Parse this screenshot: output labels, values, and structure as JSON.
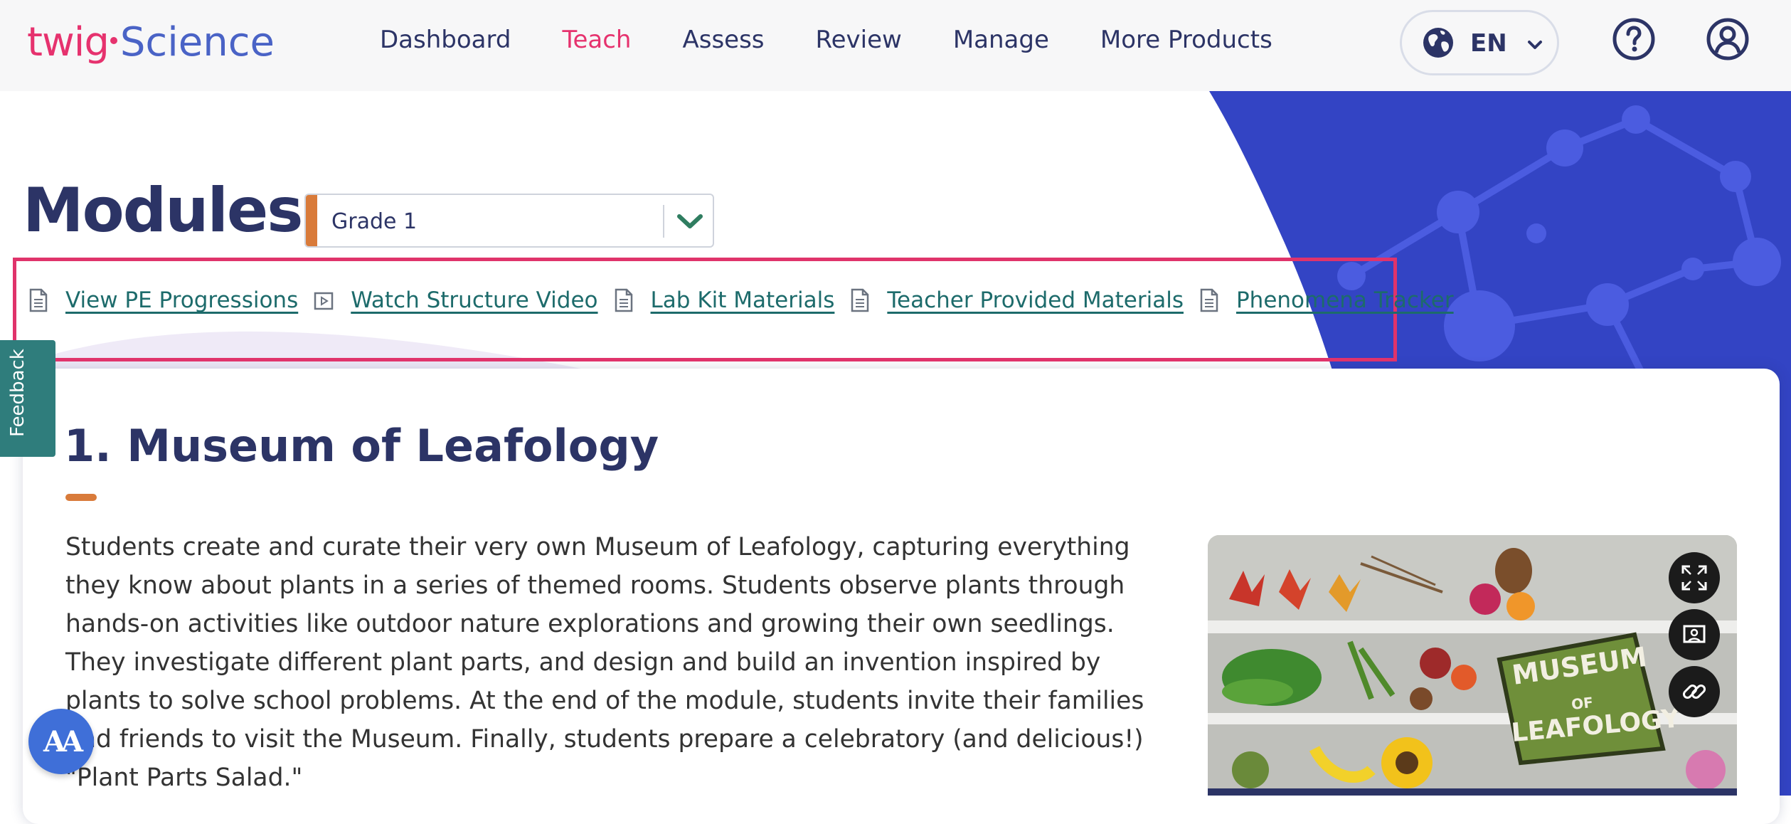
{
  "header": {
    "logo_part1": "twig",
    "logo_part2": "Science",
    "nav": [
      {
        "label": "Dashboard",
        "active": false
      },
      {
        "label": "Teach",
        "active": true
      },
      {
        "label": "Assess",
        "active": false
      },
      {
        "label": "Review",
        "active": false
      },
      {
        "label": "Manage",
        "active": false
      },
      {
        "label": "More Products",
        "active": false
      }
    ],
    "language": "EN",
    "icons": {
      "language": "globe-icon",
      "help": "help-icon",
      "profile": "user-icon"
    }
  },
  "page": {
    "title": "Modules",
    "grade_select": {
      "value": "Grade 1"
    }
  },
  "links": [
    {
      "label": "View PE Progressions",
      "icon": "document-icon"
    },
    {
      "label": "Watch Structure Video",
      "icon": "video-icon"
    },
    {
      "label": "Lab Kit Materials",
      "icon": "document-icon"
    },
    {
      "label": "Teacher Provided Materials",
      "icon": "document-icon"
    },
    {
      "label": "Phenomena Tracker",
      "icon": "document-icon"
    }
  ],
  "feedback_tab": "Feedback",
  "module": {
    "title": "1. Museum of Leafology",
    "description": "Students create and curate their very own Museum of Leafology, capturing everything they know about plants in a series of themed rooms. Students observe plants through hands-on activities like outdoor nature explorations and growing their own seedlings. They investigate different plant parts, and design and build an invention inspired by plants to solve school problems. At the end of the module, students invite their families and friends to visit the Museum. Finally, students prepare a celebratory (and delicious!) \"Plant Parts Salad.\"",
    "image_sign_line1": "MUSEUM",
    "image_sign_line2": "OF",
    "image_sign_line3": "LEAFOLOGY",
    "image_tools": [
      "fullscreen-icon",
      "present-icon",
      "link-icon"
    ]
  },
  "accessibility_button": "AA",
  "colors": {
    "brand_pink": "#e6326e",
    "navy": "#2c3466",
    "teal_link": "#1d6b6b",
    "accent_orange": "#d97b3a",
    "deco_blue": "#3344c4"
  }
}
